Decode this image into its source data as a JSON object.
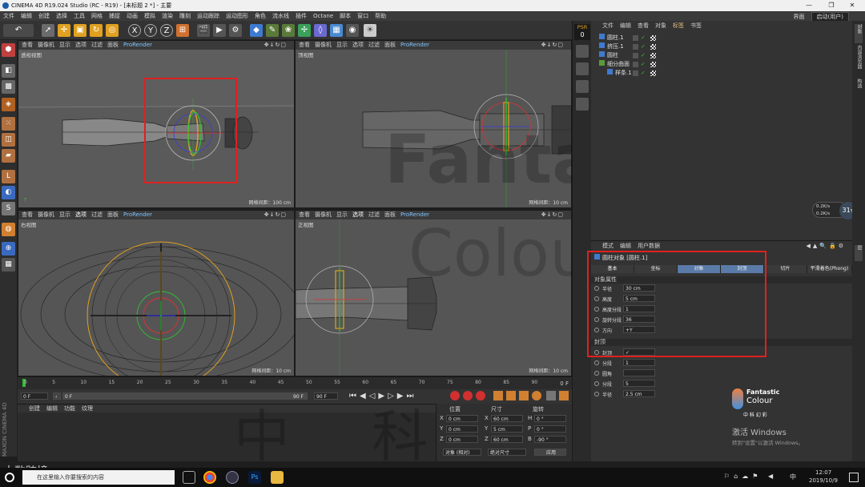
{
  "window": {
    "title": "CINEMA 4D R19.024 Studio (RC - R19) - [未标题 2 *] - 主要",
    "minimize": "—",
    "maximize": "❐",
    "close": "✕"
  },
  "menu": {
    "items": [
      "文件",
      "编辑",
      "创建",
      "选择",
      "工具",
      "网格",
      "捕捉",
      "动画",
      "模拟",
      "渲染",
      "雕刻",
      "运动跟踪",
      "运动图形",
      "角色",
      "流水线",
      "插件",
      "Octane",
      "脚本",
      "窗口",
      "帮助"
    ],
    "layout_label": "界面",
    "layout_value": "启动(用户)"
  },
  "viewports": [
    {
      "name": "透视视图",
      "menu": [
        "查看",
        "摄像机",
        "显示",
        "选项",
        "过滤",
        "面板"
      ],
      "selected": "",
      "prorender": "ProRender",
      "grid": "网格间距：100 cm"
    },
    {
      "name": "顶视图",
      "menu": [
        "查看",
        "摄像机",
        "显示",
        "选项",
        "过滤",
        "面板"
      ],
      "selected": "",
      "prorender": "ProRender",
      "grid": "网格间距：10 cm"
    },
    {
      "name": "右视图",
      "menu": [
        "查看",
        "摄像机",
        "显示",
        "选项",
        "过滤",
        "面板"
      ],
      "selected": "选项",
      "prorender": "ProRender",
      "grid": "网格间距：10 cm"
    },
    {
      "name": "正视图",
      "menu": [
        "查看",
        "摄像机",
        "显示",
        "选项",
        "过滤",
        "面板"
      ],
      "selected": "选项",
      "prorender": "ProRender",
      "grid": "网格间距：10 cm"
    }
  ],
  "timeline": {
    "ticks": [
      "0",
      "5",
      "10",
      "15",
      "20",
      "25",
      "30",
      "35",
      "40",
      "45",
      "50",
      "55",
      "60",
      "65",
      "70",
      "75",
      "80",
      "85",
      "90"
    ],
    "end_label": "0 F",
    "current": "0 F",
    "start": "0 F",
    "range_end": "90 F",
    "max": "90 F"
  },
  "material": {
    "menu": [
      "创建",
      "编辑",
      "功能",
      "纹理"
    ]
  },
  "coords": {
    "headers": [
      "位置",
      "尺寸",
      "旋转"
    ],
    "rows": [
      {
        "a": "X",
        "pos": "0 cm",
        "b": "X",
        "size": "60 cm",
        "c": "H",
        "rot": "0 °"
      },
      {
        "a": "Y",
        "pos": "0 cm",
        "b": "Y",
        "size": "5 cm",
        "c": "P",
        "rot": "0 °"
      },
      {
        "a": "Z",
        "pos": "0 cm",
        "b": "Z",
        "size": "60 cm",
        "c": "B",
        "rot": "-90 °"
      }
    ],
    "mode": "对象 (相对)",
    "size_mode": "绝对尺寸",
    "apply": "应用"
  },
  "psr": {
    "label": "PSR",
    "value": "0"
  },
  "object_manager": {
    "menu": [
      "文件",
      "编辑",
      "查看",
      "对象",
      "标签",
      "书签"
    ],
    "rows": [
      {
        "name": "圆柱.1",
        "indent": 0
      },
      {
        "name": "挤压.1",
        "indent": 0
      },
      {
        "name": "圆柱",
        "indent": 0
      },
      {
        "name": "细分曲面",
        "indent": 0
      },
      {
        "name": "样条.1",
        "indent": 1
      }
    ]
  },
  "stats": {
    "up": "0.2",
    "up_unit": "K/s",
    "down": "0.2",
    "down_unit": "K/s",
    "percent": "31",
    "percent_unit": "%"
  },
  "attributes": {
    "menu": [
      "模式",
      "编辑",
      "用户数据"
    ],
    "object_title": "圆柱对象 [圆柱.1]",
    "tabs": [
      "基本",
      "坐标",
      "对象",
      "封顶",
      "切片",
      "平滑着色(Phong)"
    ],
    "section1": "对象属性",
    "fields": [
      {
        "label": "半径",
        "value": "30 cm"
      },
      {
        "label": "高度",
        "value": "5 cm"
      },
      {
        "label": "高度分段",
        "value": "1"
      },
      {
        "label": "旋转分段",
        "value": "36"
      },
      {
        "label": "方向",
        "value": "+Y"
      }
    ],
    "section2": "封顶",
    "cap_fields": [
      {
        "label": "封顶",
        "value": "✓"
      },
      {
        "label": "分段",
        "value": "1"
      },
      {
        "label": "圆角",
        "value": ""
      },
      {
        "label": "分段",
        "value": "5"
      },
      {
        "label": "半径",
        "value": "2.5 cm"
      }
    ]
  },
  "side_tabs": [
    "对象",
    "内容浏览器",
    "构造",
    "层"
  ],
  "watermark": {
    "brand": "Fantastic",
    "brand2": "Colour",
    "cn": "中 科 幻 彩",
    "big1": "Fantastic",
    "big2": "Colour",
    "big3": "中 科 幻 彩"
  },
  "activation": {
    "line1": "激活 Windows",
    "line2": "转到\"设置\"以激活 Windows。"
  },
  "cinema_logo": "MAXON CINEMA 4D",
  "overlay_logo": "大数跨境",
  "taskbar": {
    "search": "在这里输入你要搜索的内容",
    "time": "12:07",
    "date": "2019/10/9",
    "lang": "中"
  }
}
